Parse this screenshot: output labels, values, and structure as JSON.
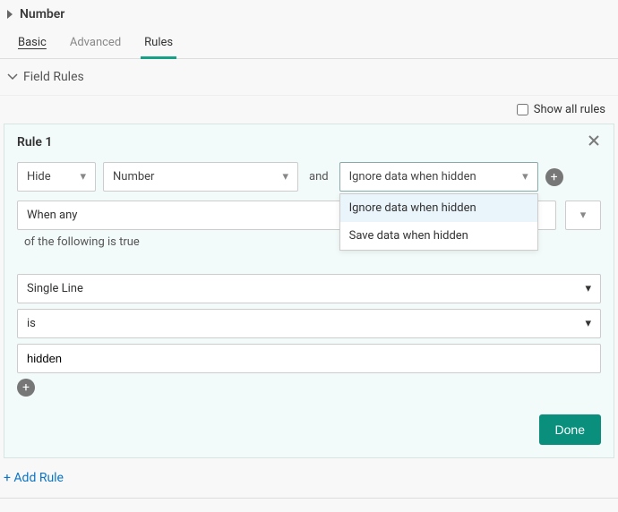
{
  "header": {
    "title": "Number"
  },
  "tabs": {
    "basic": "Basic",
    "advanced": "Advanced",
    "rules": "Rules"
  },
  "section": {
    "title": "Field Rules",
    "show_all": "Show all rules"
  },
  "rule": {
    "title": "Rule 1",
    "action": "Hide",
    "target_field": "Number",
    "and": "and",
    "data_behavior": "Ignore data when hidden",
    "dropdown": {
      "opt1": "Ignore data when hidden",
      "opt2": "Save data when hidden"
    },
    "when": "When any",
    "of_following": "of the following is true",
    "cond_field": "Single Line",
    "cond_op": "is",
    "cond_value": "hidden",
    "done": "Done"
  },
  "footer": {
    "add_rule": "+ Add Rule"
  }
}
